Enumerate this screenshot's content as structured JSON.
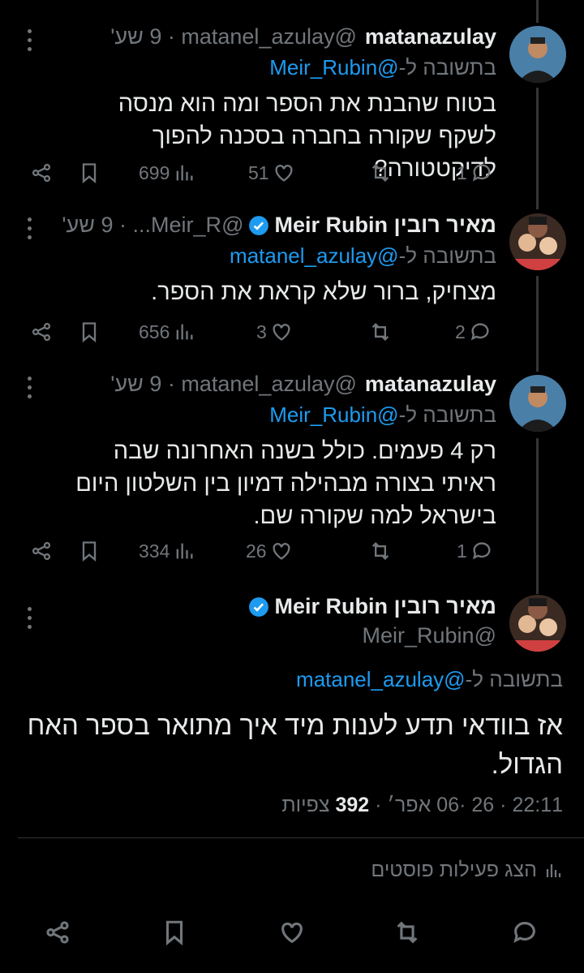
{
  "posts": [
    {
      "name": "matanazulay",
      "handle": "@matanel_azulay",
      "time": "9 שע'",
      "reply_prefix": "בתשובה ל-",
      "reply_to": "@Meir_Rubin",
      "text": "בטוח שהבנת את הספר ומה הוא מנסה לשקף שקורה בחברה בסכנה להפוך לדיקטטורה?",
      "replies": "1",
      "retweets": "",
      "likes": "51",
      "views": "699"
    },
    {
      "name": "מאיר רובין Meir Rubin",
      "handle": "@Meir_R...",
      "time": "9 שע'",
      "reply_prefix": "בתשובה ל-",
      "reply_to": "@matanel_azulay",
      "text": "מצחיק, ברור שלא קראת את הספר.",
      "replies": "2",
      "retweets": "",
      "likes": "3",
      "views": "656"
    },
    {
      "name": "matanazulay",
      "handle": "@matanel_azulay",
      "time": "9 שע'",
      "reply_prefix": "בתשובה ל-",
      "reply_to": "@Meir_Rubin",
      "text": "רק 4 פעמים. כולל בשנה האחרונה שבה ראיתי בצורה מבהילה דמיון בין השלטון היום בישראל למה שקורה שם.",
      "replies": "1",
      "retweets": "",
      "likes": "26",
      "views": "334"
    }
  ],
  "main_post": {
    "name": "מאיר רובין Meir Rubin",
    "handle": "@Meir_Rubin",
    "reply_prefix": "בתשובה ל-",
    "reply_to": "@matanel_azulay",
    "text": "אז בוודאי תדע לענות מיד איך מתואר בספר האח הגדול.",
    "time": "22:11",
    "date": "26 ·06 אפר׳",
    "views_count": "392",
    "views_label": "צפיות"
  },
  "activity_label": "הצג פעילות פוסטים",
  "colors": {
    "background": "#000000",
    "text": "#e7e9ea",
    "muted": "#71767b",
    "link": "#1d9bf0",
    "verified": "#1d9bf0"
  }
}
